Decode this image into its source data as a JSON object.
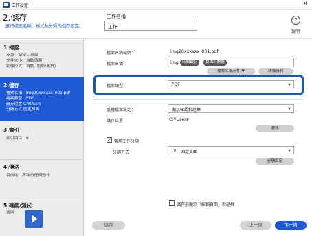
{
  "window": {
    "title": "工作設定"
  },
  "header": {
    "step_title": "2.儲存",
    "step_subtitle": "進行檔案名稱、格式及分隔的儲存設定。",
    "job_name_label": "工作名稱",
    "job_name_value": "工作",
    "help_label": "說明"
  },
  "sidebar": {
    "sections": [
      {
        "title": "1.掃描",
        "lines": [
          "來源：ADF - 單面",
          "文件大小：自動偵測",
          "影像形式：自動 (色彩/黑白)"
        ],
        "active": false
      },
      {
        "title": "2.儲存",
        "lines": [
          "檔案名稱：img20xxxxxx_001.pdf",
          "檔案類型：PDF",
          "儲存位置 C:¥Users",
          "分隔方式 固定頁面"
        ],
        "active": true
      },
      {
        "title": "3.索引",
        "lines": [
          "索引項目：6"
        ],
        "active": false
      },
      {
        "title": "4.傳送",
        "lines": [
          "目的地：不執行任何動作"
        ],
        "active": false
      },
      {
        "title": "5.確認/測試",
        "lines": [
          "畫面："
        ],
        "active": false
      }
    ]
  },
  "settings": {
    "filename_example_label": "檔案名稱範例：",
    "filename_example_value": "img20xxxxxx_001.pdf",
    "filename_label": "檔案名稱：",
    "filename_prefix": "img",
    "tag_date": "時間戳記",
    "tag_page": "頁面計數器",
    "filename_element_button": "檔案名稱元件 ▼",
    "details_button": "詳細資料",
    "filetype_label": "檔案類型：",
    "filetype_value": "PDF",
    "dest_folder_label": "重複檔案設定：",
    "dest_folder_value": "顯示確認對話框",
    "save_location_label": "儲存位置",
    "save_location_value": "C:¥Users",
    "browse_button": "瀏覽",
    "apply_separation_label": "套用工作分隔",
    "apply_separation_checked": true,
    "separation_method_label": "分隔方式",
    "separation_method_value": "固定頁面",
    "separation_settings_button": "分隔設定",
    "show_confirm_label": "儲存前顯示「編輯頁面」對話框",
    "show_confirm_checked": false
  },
  "footer": {
    "save_label": "儲存",
    "back_label": "上一頁",
    "next_label": "下一頁"
  },
  "colors": {
    "accent": "#1f5ad6",
    "highlight_border": "#1a5aa6"
  }
}
